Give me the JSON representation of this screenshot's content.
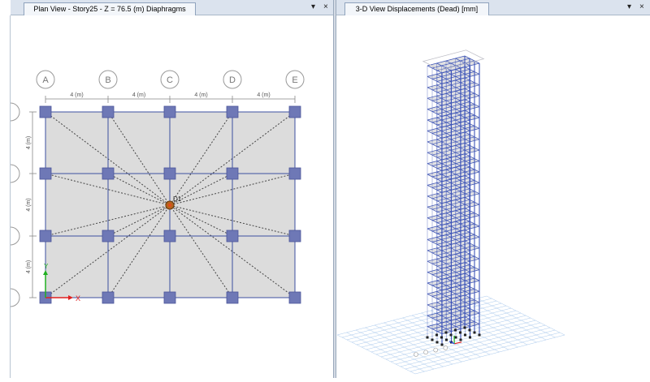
{
  "left_panel": {
    "tab_title": "Plan View - Story25 - Z = 76.5 (m)  Diaphragms",
    "dropdown_glyph": "▾",
    "close_glyph": "×",
    "grid_x": [
      "A",
      "B",
      "C",
      "D",
      "E"
    ],
    "grid_y_count": 4,
    "bay_dims_x": [
      "4 (m)",
      "4 (m)",
      "4 (m)",
      "4 (m)"
    ],
    "bay_dims_y": [
      "4 (m)",
      "4 (m)",
      "4 (m)"
    ],
    "point_label": "D1",
    "axis_x_label": "X",
    "axis_y_label": "Y",
    "colors": {
      "column": "#6e78b6",
      "slab": "#dcdcdc",
      "beam": "#3c4fa0",
      "brace": "#444444",
      "x_axis": "#e02020",
      "y_axis": "#20b020"
    }
  },
  "right_panel": {
    "tab_title": "3-D View   Displacements (Dead)  [mm]",
    "dropdown_glyph": "▾",
    "close_glyph": "×",
    "colors": {
      "frame": "#3e55b8",
      "slab": "#c8c8cc",
      "ground_grid": "#a8c8ec"
    }
  }
}
